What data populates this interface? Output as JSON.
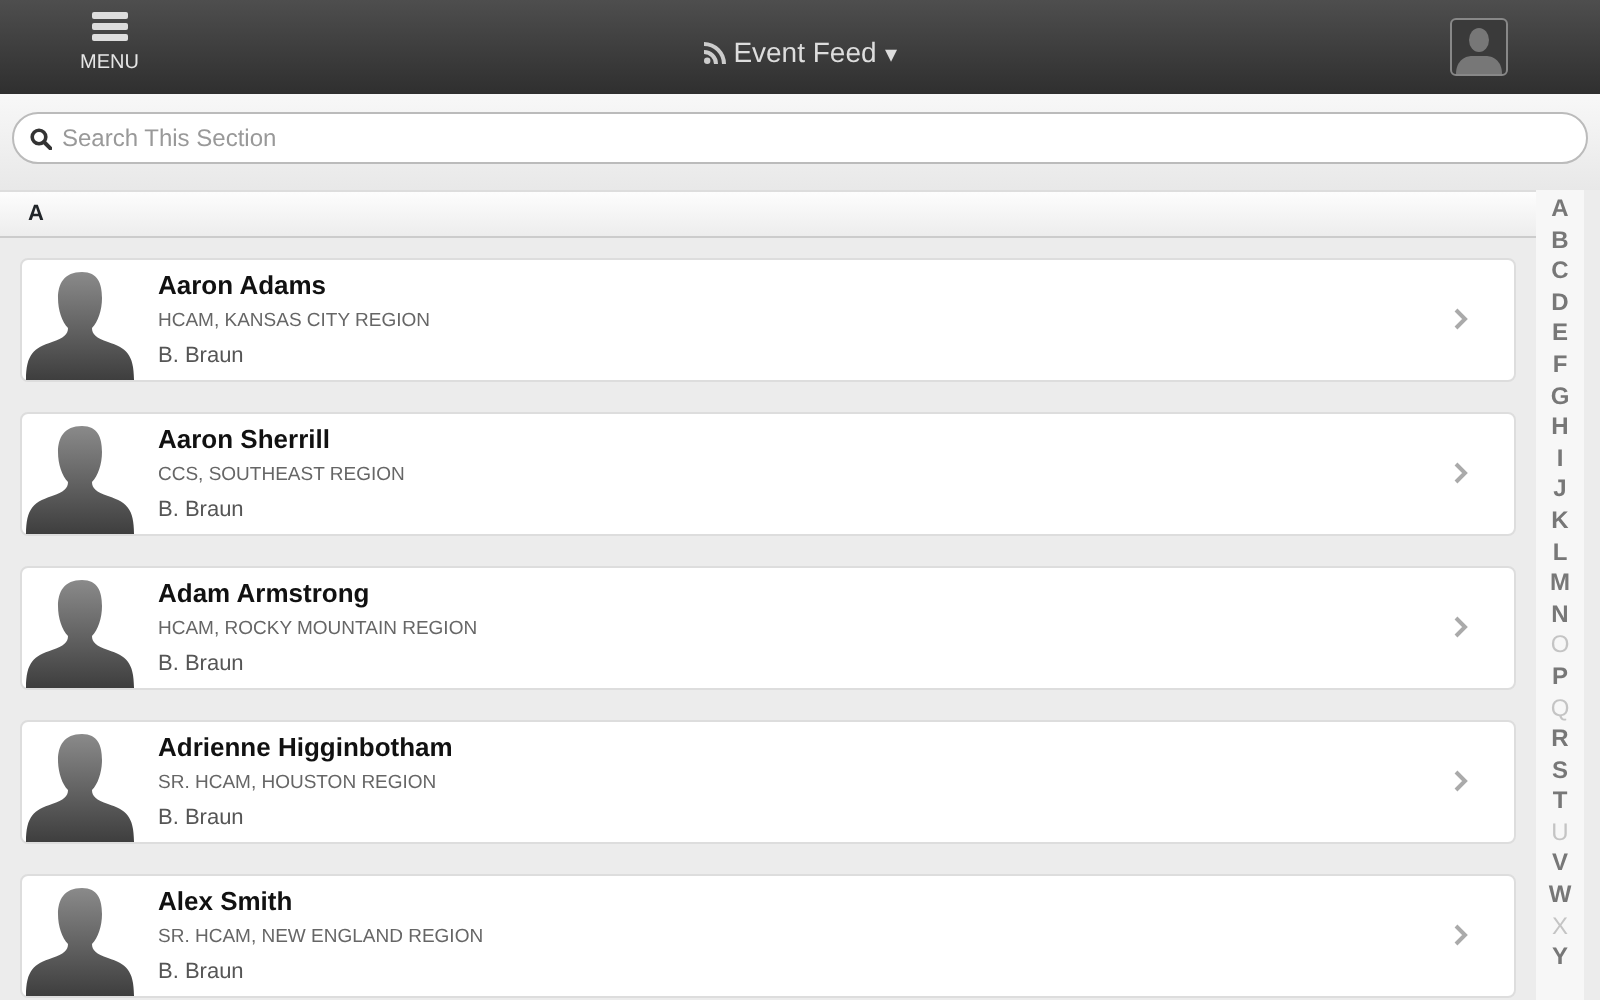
{
  "navbar": {
    "menu_label": "MENU",
    "title": "Event Feed",
    "dropdown_caret": "▾"
  },
  "search": {
    "placeholder": "Search This Section"
  },
  "section": {
    "letter": "A"
  },
  "contacts": [
    {
      "name": "Aaron Adams",
      "role": "HCAM, KANSAS CITY REGION",
      "company": "B. Braun"
    },
    {
      "name": "Aaron Sherrill",
      "role": "CCS, SOUTHEAST REGION",
      "company": "B. Braun"
    },
    {
      "name": "Adam Armstrong",
      "role": "HCAM, ROCKY MOUNTAIN REGION",
      "company": "B. Braun"
    },
    {
      "name": "Adrienne Higginbotham",
      "role": "SR. HCAM, HOUSTON REGION",
      "company": "B. Braun"
    },
    {
      "name": "Alex Smith",
      "role": "SR. HCAM, NEW ENGLAND REGION",
      "company": "B. Braun"
    }
  ],
  "index": [
    {
      "letter": "A",
      "disabled": false
    },
    {
      "letter": "B",
      "disabled": false
    },
    {
      "letter": "C",
      "disabled": false
    },
    {
      "letter": "D",
      "disabled": false
    },
    {
      "letter": "E",
      "disabled": false
    },
    {
      "letter": "F",
      "disabled": false
    },
    {
      "letter": "G",
      "disabled": false
    },
    {
      "letter": "H",
      "disabled": false
    },
    {
      "letter": "I",
      "disabled": false
    },
    {
      "letter": "J",
      "disabled": false
    },
    {
      "letter": "K",
      "disabled": false
    },
    {
      "letter": "L",
      "disabled": false
    },
    {
      "letter": "M",
      "disabled": false
    },
    {
      "letter": "N",
      "disabled": false
    },
    {
      "letter": "O",
      "disabled": true
    },
    {
      "letter": "P",
      "disabled": false
    },
    {
      "letter": "Q",
      "disabled": true
    },
    {
      "letter": "R",
      "disabled": false
    },
    {
      "letter": "S",
      "disabled": false
    },
    {
      "letter": "T",
      "disabled": false
    },
    {
      "letter": "U",
      "disabled": true
    },
    {
      "letter": "V",
      "disabled": false
    },
    {
      "letter": "W",
      "disabled": false
    },
    {
      "letter": "X",
      "disabled": true
    },
    {
      "letter": "Y",
      "disabled": false
    }
  ]
}
